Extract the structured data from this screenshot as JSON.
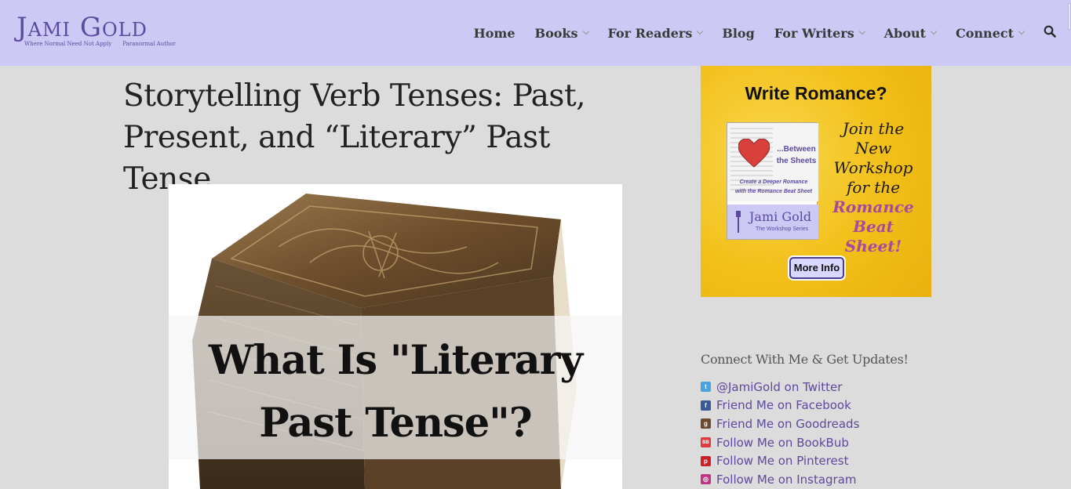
{
  "site": {
    "logo_title": "Jami Gold",
    "logo_tagline_left": "Where Normal Need Not Apply",
    "logo_tagline_right": "Paranormal Author"
  },
  "nav": {
    "items": [
      {
        "label": "Home",
        "has_dropdown": false
      },
      {
        "label": "Books",
        "has_dropdown": true
      },
      {
        "label": "For Readers",
        "has_dropdown": true
      },
      {
        "label": "Blog",
        "has_dropdown": false
      },
      {
        "label": "For Writers",
        "has_dropdown": true
      },
      {
        "label": "About",
        "has_dropdown": true
      },
      {
        "label": "Connect",
        "has_dropdown": true
      }
    ],
    "search_icon": "search-icon"
  },
  "post": {
    "title": "Storytelling Verb Tenses: Past, Present, and “Literary” Past Tense",
    "hero_text_line1": "What Is \"Literary",
    "hero_text_line2": "Past Tense\"?"
  },
  "ad": {
    "headline": "Write Romance?",
    "cover_title_line1": "...Between",
    "cover_title_line2": "the Sheets",
    "cover_subtitle_line1": "Create a Deeper Romance",
    "cover_subtitle_line2": "with the Romance Beat Sheet",
    "cover_brand": "Jami Gold",
    "cover_series": "The Workshop Series",
    "script_lines": [
      "Join the",
      "New",
      "Workshop",
      "for the"
    ],
    "script_accent_lines": [
      "Romance",
      "Beat Sheet!"
    ],
    "button_label": "More Info"
  },
  "sidebar": {
    "widget_title": "Connect With Me & Get Updates!",
    "links": [
      {
        "label": "@JamiGold on Twitter",
        "icon": "twitter-icon",
        "color": "#4aa3df",
        "glyph": "t"
      },
      {
        "label": "Friend Me on Facebook",
        "icon": "facebook-icon",
        "color": "#3b5998",
        "glyph": "f"
      },
      {
        "label": "Friend Me on Goodreads",
        "icon": "goodreads-icon",
        "color": "#6b4a2e",
        "glyph": "g"
      },
      {
        "label": "Follow Me on BookBub",
        "icon": "bookbub-icon",
        "color": "#e0393e",
        "glyph": "BB"
      },
      {
        "label": "Follow Me on Pinterest",
        "icon": "pinterest-icon",
        "color": "#cb2027",
        "glyph": "p"
      },
      {
        "label": "Follow Me on Instagram",
        "icon": "instagram-icon",
        "color": "#c13584",
        "glyph": "◎"
      }
    ]
  },
  "colors": {
    "header_bg": "#cdc9f5",
    "page_bg": "#dcdcdc",
    "brand_purple": "#5b4a9e",
    "ad_yellow": "#f3c21e"
  }
}
